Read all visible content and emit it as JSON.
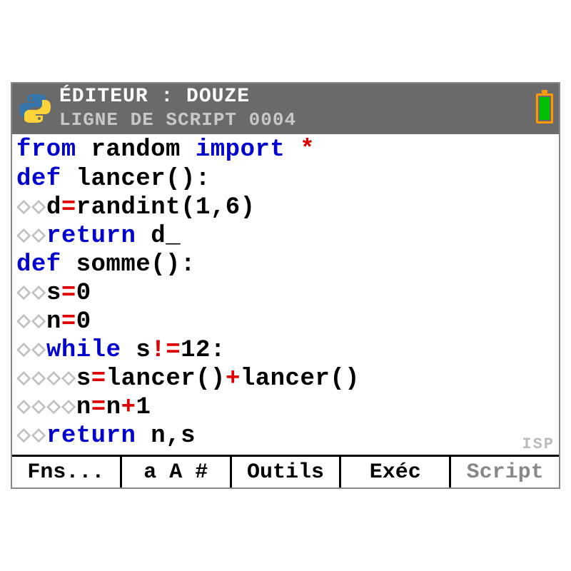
{
  "header": {
    "title": "ÉDITEUR : DOUZE",
    "subtitle": "LIGNE DE SCRIPT 0004"
  },
  "code": {
    "lines": [
      [
        {
          "t": "from",
          "c": "kw"
        },
        {
          "t": " random ",
          "c": "plain"
        },
        {
          "t": "import",
          "c": "kw"
        },
        {
          "t": " ",
          "c": "plain"
        },
        {
          "t": "*",
          "c": "op"
        }
      ],
      [
        {
          "t": "def",
          "c": "kw"
        },
        {
          "t": " lancer():",
          "c": "plain"
        }
      ],
      [
        {
          "t": "◇◇",
          "c": "dot"
        },
        {
          "t": "d",
          "c": "plain"
        },
        {
          "t": "=",
          "c": "op"
        },
        {
          "t": "randint(1,6)",
          "c": "plain"
        }
      ],
      [
        {
          "t": "◇◇",
          "c": "dot"
        },
        {
          "t": "return",
          "c": "kw"
        },
        {
          "t": " d",
          "c": "plain"
        },
        {
          "t": "_",
          "c": "cursor"
        }
      ],
      [
        {
          "t": "def",
          "c": "kw"
        },
        {
          "t": " somme():",
          "c": "plain"
        }
      ],
      [
        {
          "t": "◇◇",
          "c": "dot"
        },
        {
          "t": "s",
          "c": "plain"
        },
        {
          "t": "=",
          "c": "op"
        },
        {
          "t": "0",
          "c": "plain"
        }
      ],
      [
        {
          "t": "◇◇",
          "c": "dot"
        },
        {
          "t": "n",
          "c": "plain"
        },
        {
          "t": "=",
          "c": "op"
        },
        {
          "t": "0",
          "c": "plain"
        }
      ],
      [
        {
          "t": "◇◇",
          "c": "dot"
        },
        {
          "t": "while",
          "c": "kw"
        },
        {
          "t": " s",
          "c": "plain"
        },
        {
          "t": "!",
          "c": "op"
        },
        {
          "t": "=",
          "c": "op"
        },
        {
          "t": "12:",
          "c": "plain"
        }
      ],
      [
        {
          "t": "◇◇◇◇",
          "c": "dot"
        },
        {
          "t": "s",
          "c": "plain"
        },
        {
          "t": "=",
          "c": "op"
        },
        {
          "t": "lancer()",
          "c": "plain"
        },
        {
          "t": "+",
          "c": "op"
        },
        {
          "t": "lancer()",
          "c": "plain"
        }
      ],
      [
        {
          "t": "◇◇◇◇",
          "c": "dot"
        },
        {
          "t": "n",
          "c": "plain"
        },
        {
          "t": "=",
          "c": "op"
        },
        {
          "t": "n",
          "c": "plain"
        },
        {
          "t": "+",
          "c": "op"
        },
        {
          "t": "1",
          "c": "plain"
        }
      ],
      [
        {
          "t": "◇◇",
          "c": "dot"
        },
        {
          "t": "return",
          "c": "kw"
        },
        {
          "t": " n,s",
          "c": "plain"
        }
      ]
    ]
  },
  "softkeys": {
    "k1": "Fns...",
    "k2": "a A #",
    "k3": "Outils",
    "k4": "Exéc",
    "k5": "Script"
  },
  "watermark": "ISP"
}
